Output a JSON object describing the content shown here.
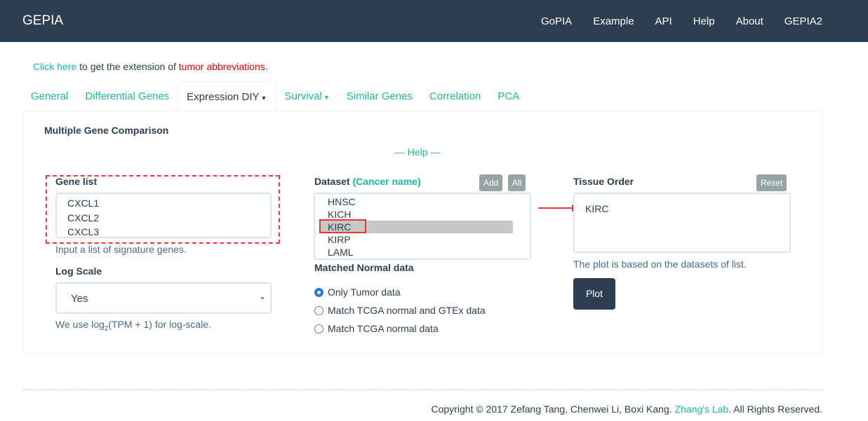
{
  "nav": {
    "brand": "GEPIA",
    "links": [
      "GoPIA",
      "Example",
      "API",
      "Help",
      "About",
      "GEPIA2"
    ]
  },
  "notice": {
    "link": "Click here",
    "middle": " to get the extension of ",
    "abbr": "tumor abbreviations",
    "end": "."
  },
  "tabs": [
    "General",
    "Differential Genes",
    "Expression DIY",
    "Survival",
    "Similar Genes",
    "Correlation",
    "PCA"
  ],
  "panel": {
    "title": "Multiple Gene Comparison",
    "help": "--- Help ---",
    "gene_list": {
      "label": "Gene list",
      "values": [
        "CXCL1",
        "CXCL2",
        "CXCL3"
      ],
      "hint": "Input a list of signature genes."
    },
    "log_scale": {
      "label": "Log Scale",
      "value": "Yes",
      "hint_pre": "We use log",
      "hint_sub": "2",
      "hint_post": "(TPM + 1) for log-scale."
    },
    "dataset": {
      "label": "Dataset",
      "label_link": "(Cancer name)",
      "add": "Add",
      "all": "All",
      "options": [
        "HNSC",
        "KICH",
        "KIRC",
        "KIRP",
        "LAML"
      ],
      "selected": "KIRC"
    },
    "matched": {
      "label": "Matched Normal data",
      "options": [
        "Only Tumor data",
        "Match TCGA normal and GTEx data",
        "Match TCGA normal data"
      ],
      "selected": "Only Tumor data"
    },
    "tissue": {
      "label": "Tissue Order",
      "reset": "Reset",
      "value": "KIRC",
      "hint": "The plot is based on the datasets of list."
    },
    "plot": "Plot"
  },
  "footer": {
    "text": "Copyright © 2017 Zefang Tang, Chenwei Li, Boxi Kang. ",
    "lab": "Zhang's Lab",
    "end": ". All Rights Reserved."
  }
}
